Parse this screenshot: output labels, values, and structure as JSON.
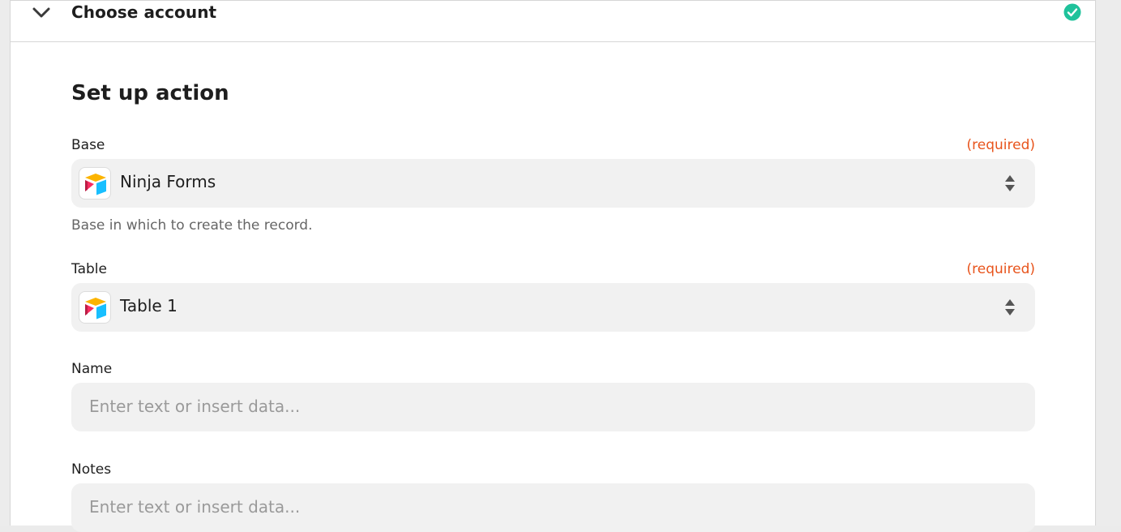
{
  "header": {
    "title": "Choose account",
    "status": "complete"
  },
  "section": {
    "title": "Set up action"
  },
  "fields": {
    "base": {
      "label": "Base",
      "required": "(required)",
      "value": "Ninja Forms",
      "help": "Base in which to create the record.",
      "icon": "airtable-icon"
    },
    "table": {
      "label": "Table",
      "required": "(required)",
      "value": "Table 1",
      "icon": "airtable-icon"
    },
    "name": {
      "label": "Name",
      "placeholder": "Enter text or insert data..."
    },
    "notes": {
      "label": "Notes",
      "placeholder": "Enter text or insert data..."
    }
  },
  "colors": {
    "accent_required": "#e8541c",
    "success": "#1fc29b",
    "field_bg": "#f1f1f1"
  }
}
